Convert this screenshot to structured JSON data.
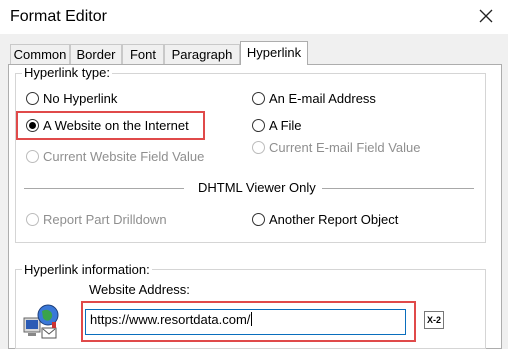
{
  "window": {
    "title": "Format Editor"
  },
  "tabs": [
    {
      "label": "Common"
    },
    {
      "label": "Border"
    },
    {
      "label": "Font"
    },
    {
      "label": "Paragraph"
    },
    {
      "label": "Hyperlink"
    }
  ],
  "hyperlink_type": {
    "legend": "Hyperlink type:",
    "options": {
      "no_hyperlink": "No Hyperlink",
      "email": "An E-mail Address",
      "website": "A Website on the Internet",
      "file": "A File",
      "current_website_field": "Current Website Field Value",
      "current_email_field": "Current E-mail Field Value",
      "report_part_drilldown": "Report Part Drilldown",
      "another_report_object": "Another Report Object"
    },
    "selected": "A Website on the Internet",
    "dhtml_label": "DHTML Viewer Only"
  },
  "hyperlink_info": {
    "legend": "Hyperlink information:",
    "address_label": "Website Address:",
    "address_value": "https://www.resortdata.com/",
    "formula_button_label": "X-2"
  },
  "colors": {
    "highlight": "#e04a4a",
    "focus_border": "#0a6ebd",
    "dialog_bg": "#f0f0f0"
  }
}
